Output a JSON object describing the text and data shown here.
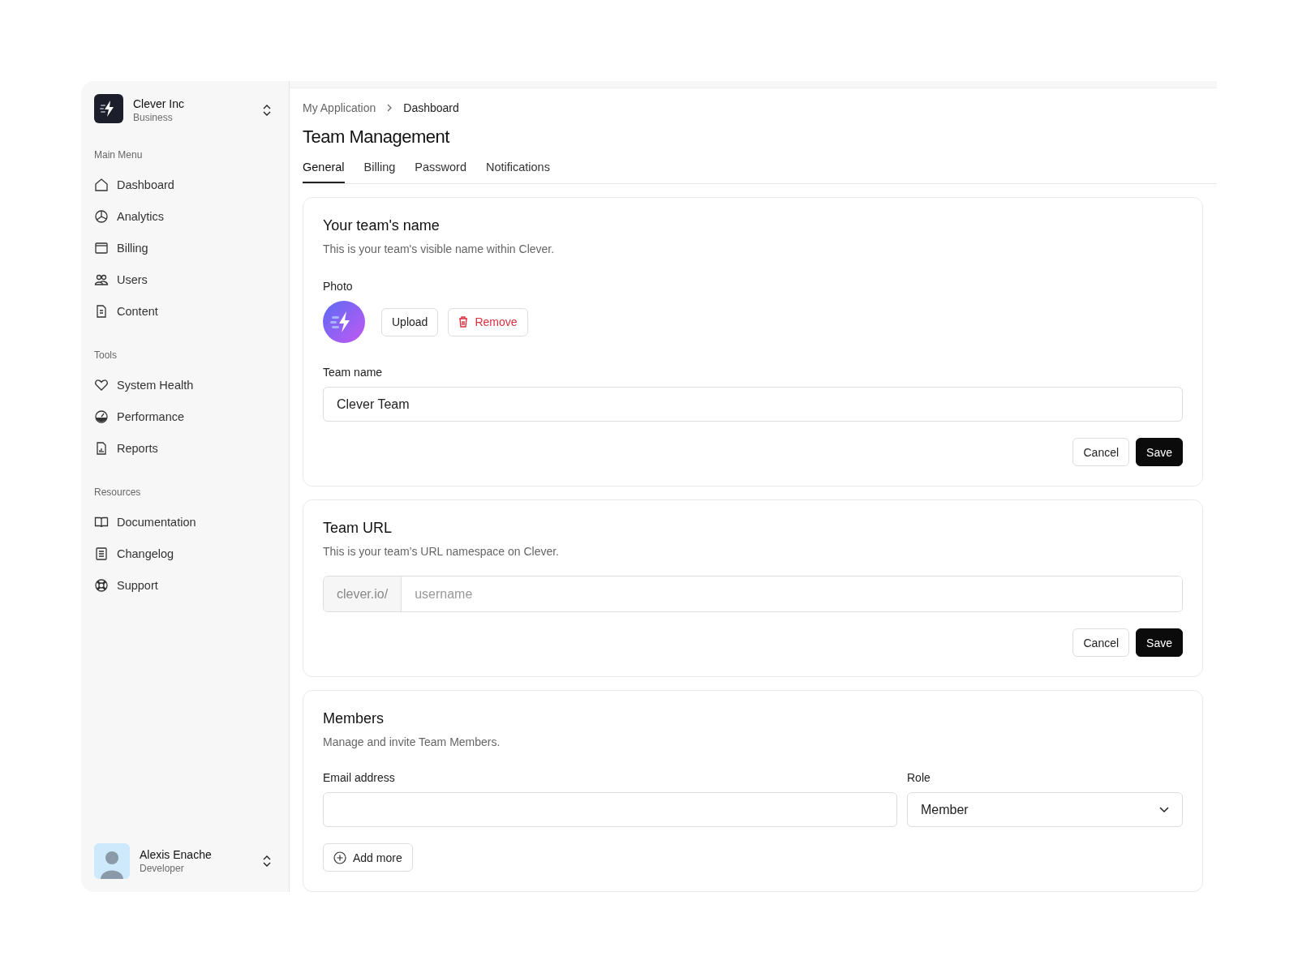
{
  "org": {
    "name": "Clever Inc",
    "plan": "Business"
  },
  "sidebar": {
    "sections": [
      {
        "title": "Main Menu",
        "items": [
          {
            "label": "Dashboard"
          },
          {
            "label": "Analytics"
          },
          {
            "label": "Billing"
          },
          {
            "label": "Users"
          },
          {
            "label": "Content"
          }
        ]
      },
      {
        "title": "Tools",
        "items": [
          {
            "label": "System Health"
          },
          {
            "label": "Performance"
          },
          {
            "label": "Reports"
          }
        ]
      },
      {
        "title": "Resources",
        "items": [
          {
            "label": "Documentation"
          },
          {
            "label": "Changelog"
          },
          {
            "label": "Support"
          }
        ]
      }
    ]
  },
  "user": {
    "name": "Alexis Enache",
    "role": "Developer"
  },
  "breadcrumb": [
    "My Application",
    "Dashboard"
  ],
  "title": "Team Management",
  "tabs": [
    {
      "label": "General",
      "selected": true
    },
    {
      "label": "Billing",
      "selected": false
    },
    {
      "label": "Password",
      "selected": false
    },
    {
      "label": "Notifications",
      "selected": false
    }
  ],
  "team_name_card": {
    "title": "Your team's name",
    "description": "This is your team's visible name within Clever.",
    "photo_label": "Photo",
    "upload": "Upload",
    "remove": "Remove",
    "field_label": "Team name",
    "value": "Clever Team",
    "cancel": "Cancel",
    "save": "Save"
  },
  "team_url_card": {
    "title": "Team URL",
    "description": "This is your team’s URL namespace on Clever.",
    "prefix": "clever.io/",
    "placeholder": "username",
    "cancel": "Cancel",
    "save": "Save"
  },
  "members_card": {
    "title": "Members",
    "description": "Manage and invite Team Members.",
    "email_label": "Email address",
    "role_label": "Role",
    "role_value": "Member",
    "add_more": "Add more"
  }
}
